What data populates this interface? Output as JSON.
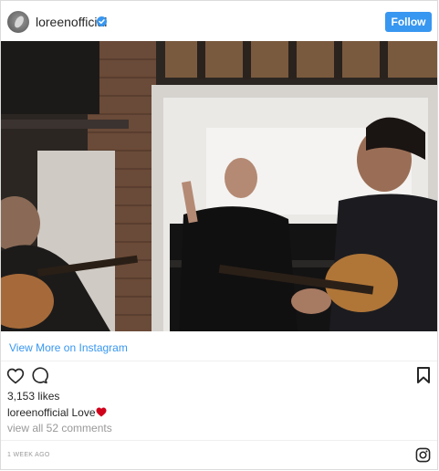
{
  "header": {
    "username": "loreenofficial",
    "verified": true,
    "follow_label": "Follow"
  },
  "photo": {
    "alt": "photo"
  },
  "links": {
    "view_more": "View More on Instagram"
  },
  "actions": {
    "like_icon": "heart-icon",
    "comment_icon": "comment-icon",
    "save_icon": "bookmark-icon"
  },
  "post": {
    "likes": "3,153 likes",
    "caption_user": "loreenofficial",
    "caption_text": "Love",
    "caption_emoji": "red-heart",
    "comments_link": "view all 52 comments",
    "timestamp": "1 WEEK AGO"
  },
  "footer": {
    "brand_icon": "instagram-icon"
  },
  "colors": {
    "accent": "#3897f0",
    "text": "#262626",
    "muted": "#999999",
    "heart": "#ed4956"
  }
}
